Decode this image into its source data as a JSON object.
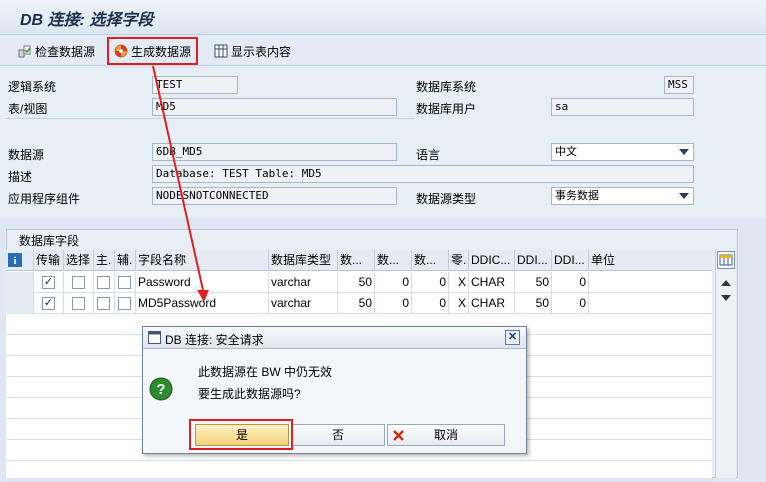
{
  "window": {
    "title": "DB 连接: 选择字段"
  },
  "toolbar": {
    "check_label": "检查数据源",
    "generate_label": "生成数据源",
    "show_label": "显示表内容"
  },
  "form": {
    "logical_system_label": "逻辑系统",
    "logical_system_value": "TEST",
    "table_view_label": "表/视图",
    "table_view_value": "MD5",
    "db_system_label": "数据库系统",
    "db_system_value": "MSS",
    "db_user_label": "数据库用户",
    "db_user_value": "sa",
    "datasource_label": "数据源",
    "datasource_value": "6DB_MD5",
    "language_label": "语言",
    "language_value": "中文",
    "description_label": "描述",
    "description_value": "Database: TEST Table: MD5",
    "app_component_label": "应用程序组件",
    "app_component_value": "NODESNOTCONNECTED",
    "datasource_type_label": "数据源类型",
    "datasource_type_value": "事务数据"
  },
  "fields_group": {
    "title": "数据库字段",
    "columns": [
      "传输",
      "选择",
      "主.",
      "辅.",
      "字段名称",
      "数据库类型",
      "数...",
      "数...",
      "数...",
      "零.",
      "DDIC...",
      "DDI...",
      "DDI...",
      "单位"
    ],
    "rows": [
      {
        "transfer": "✓",
        "name": "Password",
        "dbtype": "varchar",
        "n1": "50",
        "n2": "0",
        "n3": "0",
        "zero": "X",
        "ddic": "CHAR",
        "ddi1": "50",
        "ddi2": "0",
        "unit": ""
      },
      {
        "transfer": "✓",
        "name": "MD5Password",
        "dbtype": "varchar",
        "n1": "50",
        "n2": "0",
        "n3": "0",
        "zero": "X",
        "ddic": "CHAR",
        "ddi1": "50",
        "ddi2": "0",
        "unit": ""
      }
    ]
  },
  "dialog": {
    "title": "DB 连接: 安全请求",
    "line1": "此数据源在 BW 中仍无效",
    "line2": "要生成此数据源吗?",
    "yes_label": "是",
    "no_label": "否",
    "cancel_label": "取消"
  },
  "colors": {
    "highlight": "#e02020",
    "button_yellow": "#f4d27a"
  },
  "icons": [
    "check-icon",
    "generate-icon",
    "table-icon",
    "info-icon",
    "layout-icon",
    "question-icon",
    "cancel-x-icon"
  ]
}
